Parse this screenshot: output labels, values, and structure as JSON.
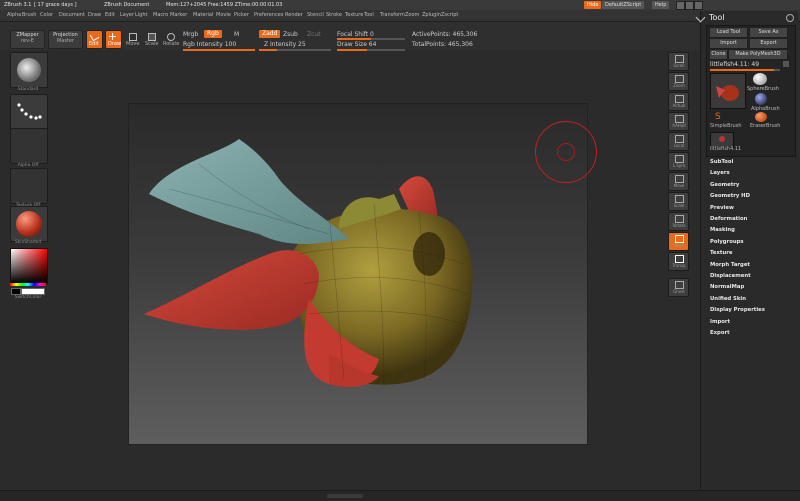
{
  "titlebar": {
    "app": "ZBrush 3.1",
    "trial": "[ 17 grace days ]",
    "document": "ZBrush Document",
    "stats": "Mem:127+2045 Free:1459 ZTime:00:00:01.03",
    "hide_btn": "Hide",
    "script_btn": "DefaultZScript",
    "help_btn": "Help"
  },
  "menu": [
    "Alpha",
    "Brush",
    "Color",
    "Document",
    "Draw",
    "Edit",
    "Layer",
    "Light",
    "Macro",
    "Marker",
    "Material",
    "Movie",
    "Picker",
    "Preferences",
    "Render",
    "Stencil",
    "Stroke",
    "Texture",
    "Tool",
    "Transform",
    "Zoom",
    "Zplugin",
    "Zscript"
  ],
  "toolbar": {
    "zmapper": "ZMapper",
    "zmapper_sub": "rev-E",
    "projection": "Projection",
    "projection_sub": "Master",
    "edit": "Edit",
    "draw": "Draw",
    "move": "Move",
    "scale": "Scale",
    "rotate": "Rotate",
    "mrgb": "Mrgb",
    "rgb": "Rgb",
    "m": "M",
    "zadd": "Zadd",
    "zsub": "Zsub",
    "zcut": "Zcut",
    "rgb_intensity": "Rgb Intensity 100",
    "z_intensity": "Z Intensity 25",
    "focal_shift": "Focal Shift 0",
    "draw_size": "Draw Size 64",
    "active_points": "ActivePoints: 465,306",
    "total_points": "TotalPoints: 465,306"
  },
  "leftshelf": {
    "brush_label": "Standard",
    "stroke_label": "Dots",
    "alpha_label": "Alpha Off",
    "texture_label": "Texture Off",
    "material_label": "SkinShade4",
    "color_label": "SwitchColor"
  },
  "rightshelf": [
    "Scroll",
    "Zoom",
    "Actual",
    "AAHalf",
    "Local",
    "L.Sym",
    "Move",
    "Scale",
    "Rotate",
    "PolyF",
    "Transp",
    "Ghost"
  ],
  "palette": {
    "title": "Tool",
    "load_tool": "Load Tool",
    "save_as": "Save As",
    "import": "Import",
    "export": "Export",
    "clone": "Clone",
    "make_polymesh": "Make PolyMesh3D",
    "current_tool": "littlefish4.11: 49",
    "tools": [
      "littlefish4.11",
      "SphereBrush",
      "AlphaBrush",
      "SimpleBrush",
      "EraserBrush",
      "littlefish4.11"
    ],
    "sections": [
      "SubTool",
      "Layers",
      "Geometry",
      "Geometry HD",
      "Preview",
      "Deformation",
      "Masking",
      "Polygroups",
      "Texture",
      "Morph Target",
      "Displacement",
      "NormalMap",
      "Unified Skin",
      "Display Properties",
      "Import",
      "Export"
    ]
  },
  "colors": {
    "accent": "#e86a1a",
    "fish_body": "#8a7a2a",
    "fish_mask": "#c23a30",
    "fin": "#7aa3a3"
  }
}
